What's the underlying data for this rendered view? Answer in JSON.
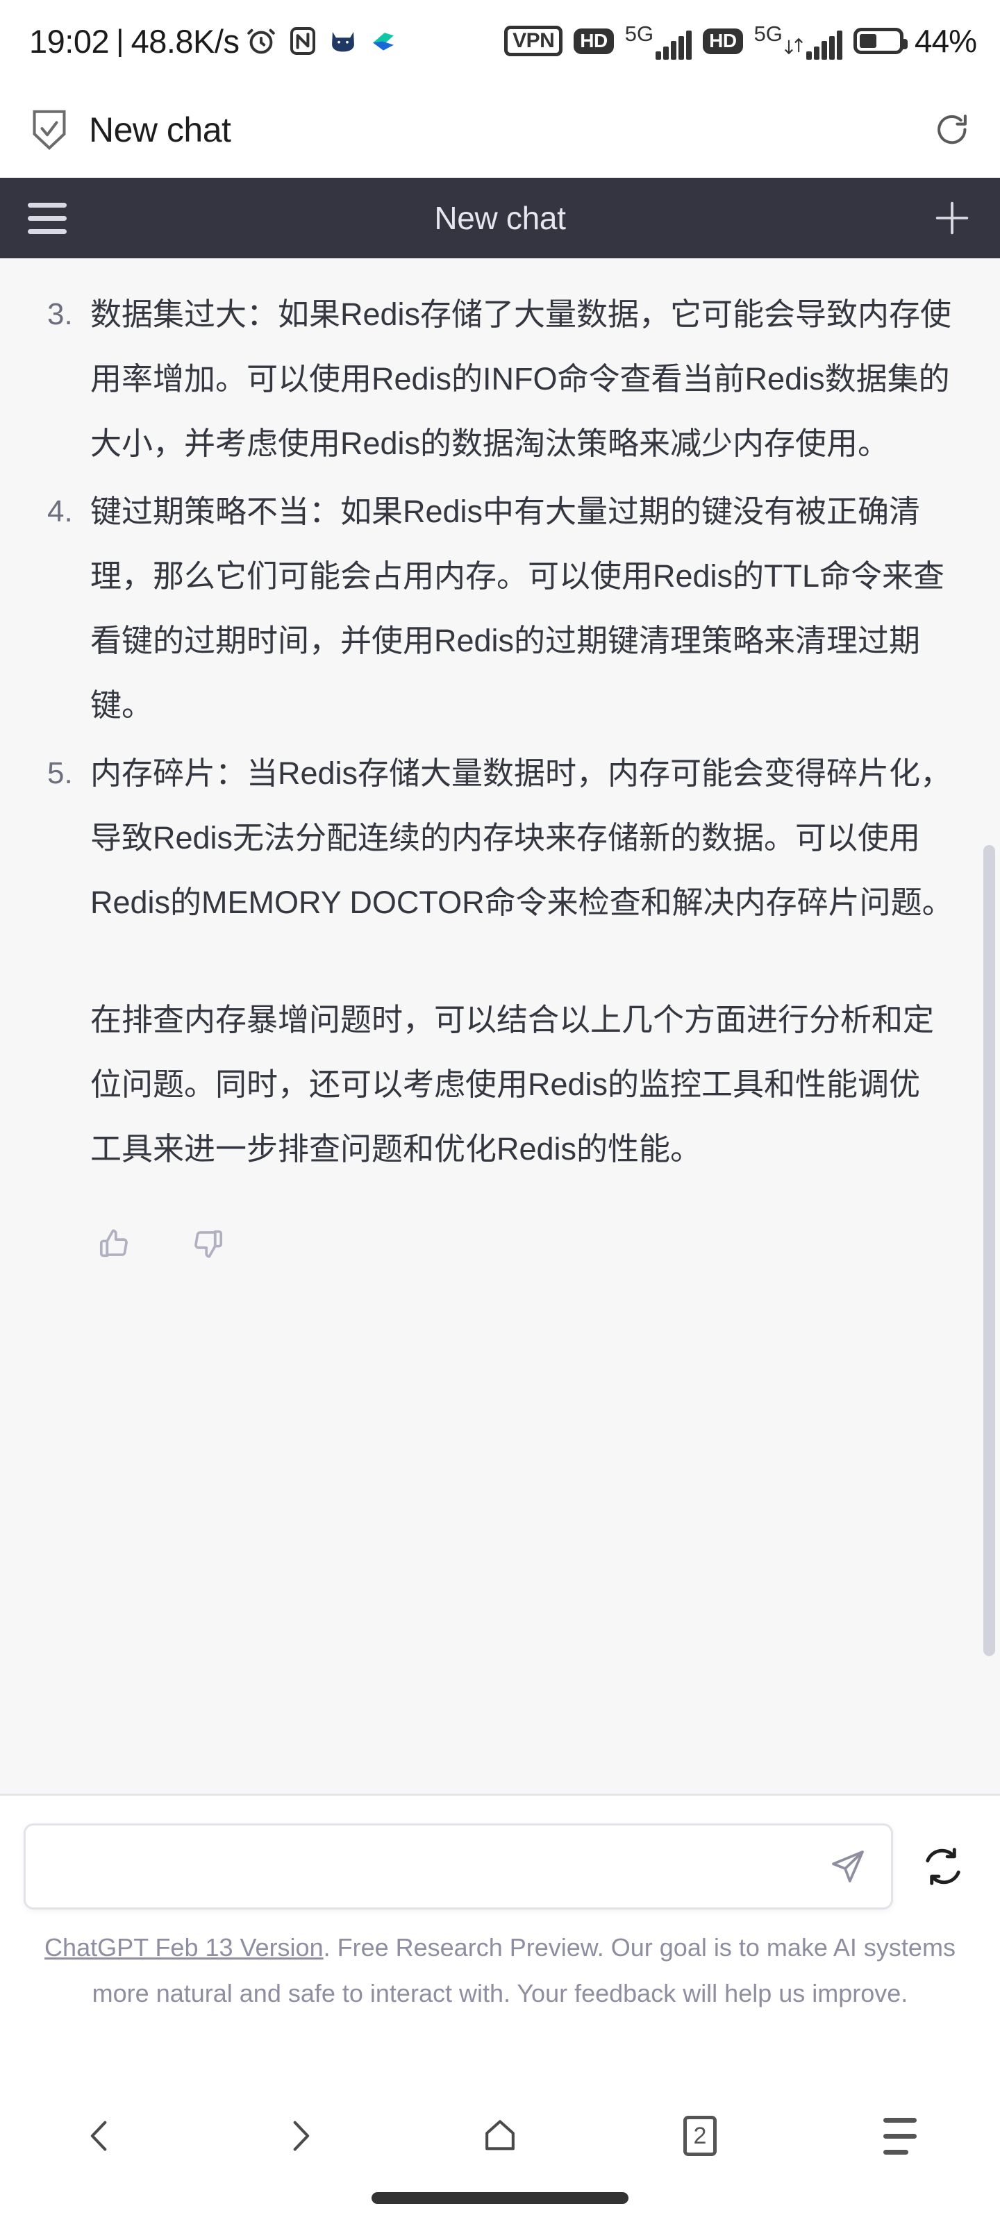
{
  "statusbar": {
    "time": "19:02",
    "separator": "|",
    "network_speed": "48.8K/s",
    "vpn_label": "VPN",
    "hd_label_1": "HD",
    "gen_label_1": "5G",
    "hd_label_2": "HD",
    "gen_label_2": "5G",
    "battery_percent": "44%",
    "battery_level": 44,
    "icons": [
      "alarm-icon",
      "nfc-icon",
      "cat-app-icon",
      "leaf-app-icon"
    ]
  },
  "browser_bar": {
    "shield_icon": "shield-check-icon",
    "title": "New chat",
    "reload_icon": "reload-icon"
  },
  "app_header": {
    "menu_icon": "hamburger-menu-icon",
    "title": "New chat",
    "new_chat_icon": "plus-icon",
    "background_color": "#343541"
  },
  "conversation": {
    "list_items": [
      {
        "number": "3.",
        "text": "数据集过大：如果Redis存储了大量数据，它可能会导致内存使用率增加。可以使用Redis的INFO命令查看当前Redis数据集的大小，并考虑使用Redis的数据淘汰策略来减少内存使用。"
      },
      {
        "number": "4.",
        "text": "键过期策略不当：如果Redis中有大量过期的键没有被正确清理，那么它们可能会占用内存。可以使用Redis的TTL命令来查看键的过期时间，并使用Redis的过期键清理策略来清理过期键。"
      },
      {
        "number": "5.",
        "text": "内存碎片：当Redis存储大量数据时，内存可能会变得碎片化，导致Redis无法分配连续的内存块来存储新的数据。可以使用Redis的MEMORY DOCTOR命令来检查和解决内存碎片问题。"
      }
    ],
    "closing_paragraph": "在排查内存暴增问题时，可以结合以上几个方面进行分析和定位问题。同时，还可以考虑使用Redis的监控工具和性能调优工具来进一步排查问题和优化Redis的性能。",
    "feedback": {
      "thumbs_up_icon": "thumbs-up-icon",
      "thumbs_down_icon": "thumbs-down-icon"
    }
  },
  "composer": {
    "input_value": "",
    "input_placeholder": "",
    "send_icon": "send-paper-plane-icon",
    "regenerate_icon": "regenerate-icon"
  },
  "footer": {
    "link_text": "ChatGPT Feb 13 Version",
    "rest_text": ". Free Research Preview. Our goal is to make AI systems more natural and safe to interact with. Your feedback will help us improve."
  },
  "bottom_nav": {
    "back_icon": "chevron-left-icon",
    "forward_icon": "chevron-right-icon",
    "home_icon": "home-icon",
    "tabs_count": "2",
    "menu_icon": "more-menu-icon"
  }
}
